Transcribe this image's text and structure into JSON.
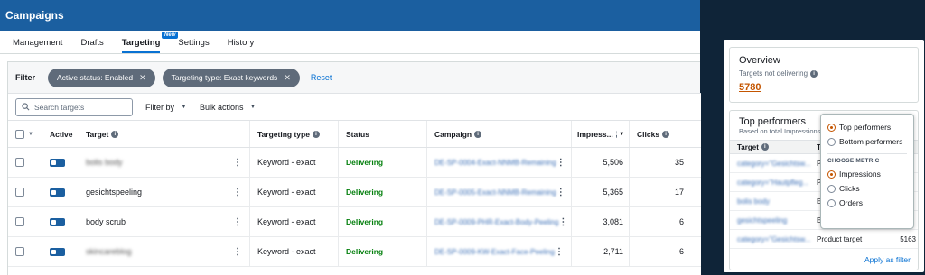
{
  "app": {
    "title": "Campaigns"
  },
  "tabs": [
    {
      "label": "Management"
    },
    {
      "label": "Drafts"
    },
    {
      "label": "Targeting",
      "badge": "New"
    },
    {
      "label": "Settings"
    },
    {
      "label": "History"
    }
  ],
  "filter": {
    "label": "Filter",
    "chips": [
      "Active status: Enabled",
      "Targeting type: Exact keywords"
    ],
    "reset": "Reset"
  },
  "toolbar": {
    "search_placeholder": "Search targets",
    "filter_by": "Filter by",
    "bulk_actions": "Bulk actions"
  },
  "table": {
    "headers": {
      "active": "Active",
      "target": "Target",
      "targeting_type": "Targeting type",
      "status": "Status",
      "campaign": "Campaign",
      "impressions": "Impress...",
      "clicks": "Clicks"
    },
    "rows": [
      {
        "target": "bolis body",
        "targeting_type": "Keyword - exact",
        "status": "Delivering",
        "campaign": "DE-SP-0004-Exact-NNMB-Remaining",
        "impressions": "5,506",
        "clicks": "35"
      },
      {
        "target": "gesichtspeeling",
        "targeting_type": "Keyword - exact",
        "status": "Delivering",
        "campaign": "DE-SP-0005-Exact-NNMB-Remaining",
        "impressions": "5,365",
        "clicks": "17"
      },
      {
        "target": "body scrub",
        "targeting_type": "Keyword - exact",
        "status": "Delivering",
        "campaign": "DE-SP-0009-PHR-Exact-Body-Peeling",
        "impressions": "3,081",
        "clicks": "6"
      },
      {
        "target": "skincareblog",
        "targeting_type": "Keyword - exact",
        "status": "Delivering",
        "campaign": "DE-SP-0009-KW-Exact-Face-Peeling",
        "impressions": "2,711",
        "clicks": "6"
      }
    ]
  },
  "overview": {
    "title": "Overview",
    "subtitle": "Targets not delivering",
    "value": "5780"
  },
  "top_performers": {
    "title": "Top performers",
    "subtitle": "Based on total Impressions",
    "header_target": "Target",
    "header_type": "Ty",
    "rows": [
      {
        "target": "category=\"Gesichtsw...",
        "type": "Pr",
        "value": ""
      },
      {
        "target": "category=\"Hautpfleg...",
        "type": "Pr",
        "value": ""
      },
      {
        "target": "bolis body",
        "type": "Ex",
        "value": ""
      },
      {
        "target": "gesichtspeeling",
        "type": "Ex",
        "value": ""
      },
      {
        "target": "category=\"Gesichtsw...",
        "type": "Product target",
        "value": "5163"
      }
    ],
    "apply": "Apply as filter"
  },
  "popover": {
    "options": [
      "Top performers",
      "Bottom performers"
    ],
    "metric_label": "CHOOSE METRIC",
    "metrics": [
      "Impressions",
      "Clicks",
      "Orders"
    ]
  }
}
